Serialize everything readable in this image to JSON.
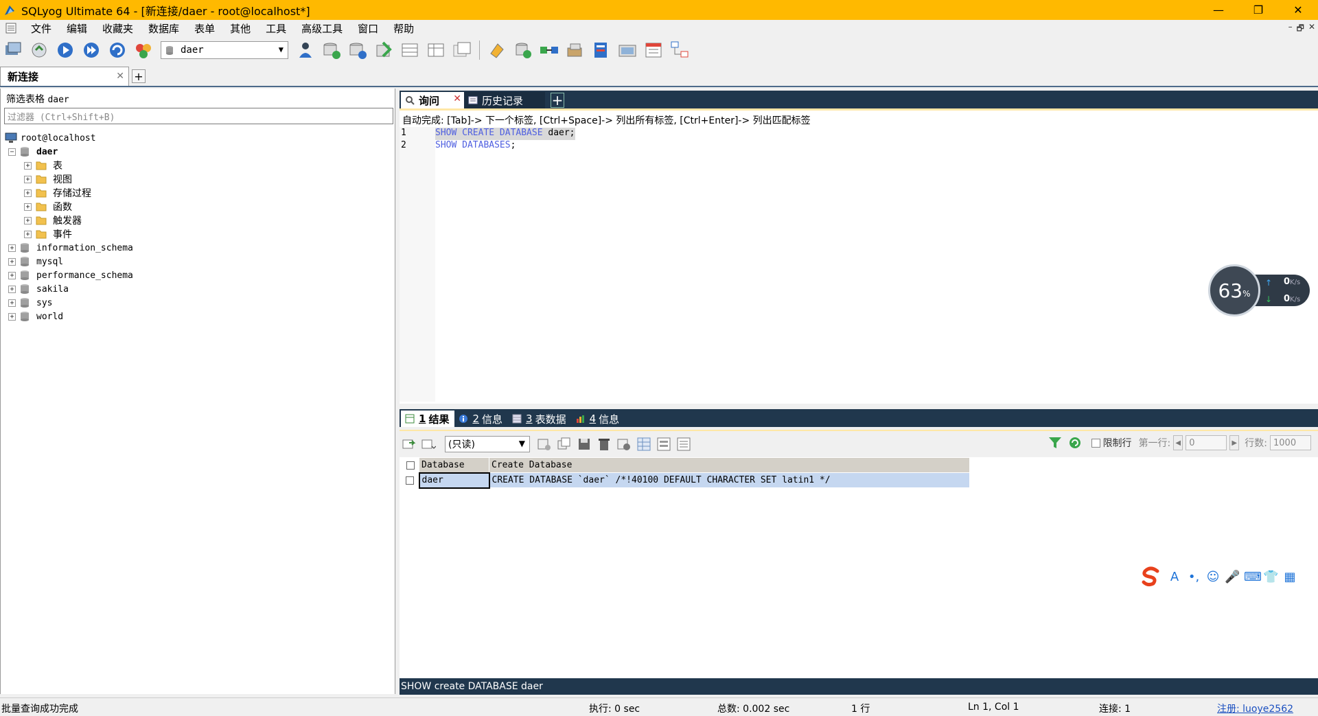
{
  "window": {
    "title": "SQLyog Ultimate 64 - [新连接/daer - root@localhost*]",
    "controls": {
      "minimize": "—",
      "restore": "❐",
      "close": "✕"
    }
  },
  "menu": {
    "items": [
      "文件",
      "编辑",
      "收藏夹",
      "数据库",
      "表单",
      "其他",
      "工具",
      "高级工具",
      "窗口",
      "帮助"
    ],
    "mdi_controls": {
      "minimize": "–",
      "restore": "🗗",
      "close": "✕"
    }
  },
  "toolbar": {
    "database_select": "daer"
  },
  "connection_tabs": [
    {
      "label": "新连接",
      "close": "✕"
    }
  ],
  "connection_add": "+",
  "object_browser": {
    "filter_label": "筛选表格",
    "filter_db": "daer",
    "filter_placeholder": "过滤器 (Ctrl+Shift+B)",
    "root": "root@localhost",
    "active_db": "daer",
    "active_db_children": [
      "表",
      "视图",
      "存储过程",
      "函数",
      "触发器",
      "事件"
    ],
    "other_dbs": [
      "information_schema",
      "mysql",
      "performance_schema",
      "sakila",
      "sys",
      "world"
    ],
    "expand_symbol": "+",
    "collapse_symbol": "−"
  },
  "editor_tabs": {
    "query_tab": "询问",
    "query_close": "✕",
    "history_tab": "历史记录",
    "add": "+"
  },
  "editor": {
    "hint": "自动完成: [Tab]-> 下一个标签, [Ctrl+Space]-> 列出所有标签, [Ctrl+Enter]-> 列出匹配标签",
    "lines": [
      {
        "num": "1",
        "kw": "SHOW CREATE DATABASE",
        "rest": " daer;"
      },
      {
        "num": "2",
        "kw": "SHOW DATABASES",
        "rest": ";"
      }
    ]
  },
  "net_widget": {
    "cpu": "63",
    "cpu_unit": "%",
    "up_value": "0",
    "down_value": "0",
    "unit": "K/s",
    "up_arrow": "↑",
    "down_arrow": "↓"
  },
  "result_tabs": [
    {
      "num": "1",
      "label": "结果"
    },
    {
      "num": "2",
      "label": "信息"
    },
    {
      "num": "3",
      "label": "表数据"
    },
    {
      "num": "4",
      "label": "信息"
    }
  ],
  "result_toolbar": {
    "mode": "(只读)",
    "limit_label": "限制行",
    "first_row_label": "第一行:",
    "first_row_value": "0",
    "rows_label": "行数:",
    "rows_value": "1000",
    "prev": "◀",
    "next": "▶"
  },
  "result_grid": {
    "columns": [
      "Database",
      "Create Database"
    ],
    "rows": [
      [
        "daer",
        "CREATE DATABASE `daer` /*!40100 DEFAULT CHARACTER SET latin1 */"
      ]
    ]
  },
  "query_status": "SHOW create DATABASE daer",
  "ime": {
    "icons": [
      "A",
      "•,",
      "☺",
      "🎤",
      "⌨",
      "👕",
      "▦"
    ]
  },
  "status_bar": {
    "message": "批量查询成功完成",
    "exec": "执行: 0 sec",
    "total": "总数: 0.002 sec",
    "rows": "1 行",
    "position": "Ln 1, Col 1",
    "connections": "连接: 1",
    "register": "注册: luoye2562"
  },
  "colors": {
    "title_bar": "#ffb900",
    "tab_strip": "#20374d",
    "keyword": "#5060e0",
    "selected_row": "#c5d7f0"
  }
}
